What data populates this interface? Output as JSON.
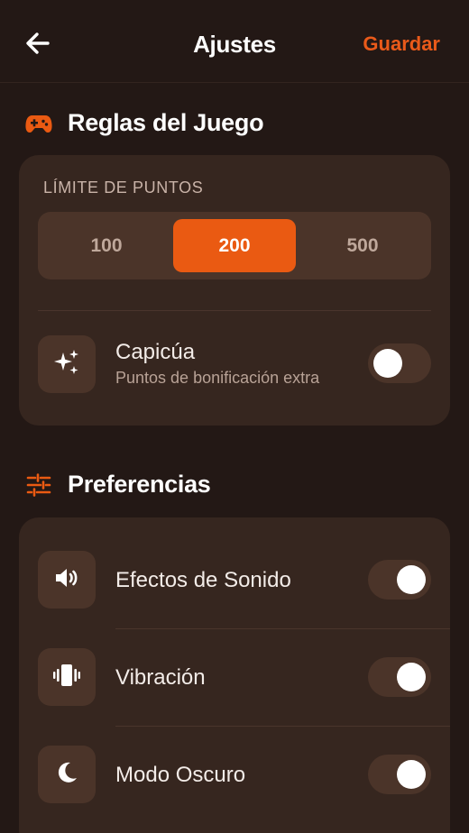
{
  "header": {
    "title": "Ajustes",
    "save_label": "Guardar",
    "back_icon": "arrow-left-icon"
  },
  "colors": {
    "accent": "#ea5a12",
    "background": "#231815",
    "card": "#36261f",
    "control": "#4b3429"
  },
  "game_rules": {
    "section_title": "Reglas del Juego",
    "section_icon": "gamepad-icon",
    "points_limit": {
      "label": "LÍMITE DE PUNTOS",
      "options": [
        "100",
        "200",
        "500"
      ],
      "selected": "200"
    },
    "capicua": {
      "icon": "sparkles-icon",
      "title": "Capicúa",
      "subtitle": "Puntos de bonificación extra",
      "enabled": false
    }
  },
  "preferences": {
    "section_title": "Preferencias",
    "section_icon": "sliders-icon",
    "items": [
      {
        "icon": "speaker-icon",
        "label": "Efectos de Sonido",
        "enabled": true
      },
      {
        "icon": "vibration-icon",
        "label": "Vibración",
        "enabled": true
      },
      {
        "icon": "moon-icon",
        "label": "Modo Oscuro",
        "enabled": true
      }
    ]
  }
}
